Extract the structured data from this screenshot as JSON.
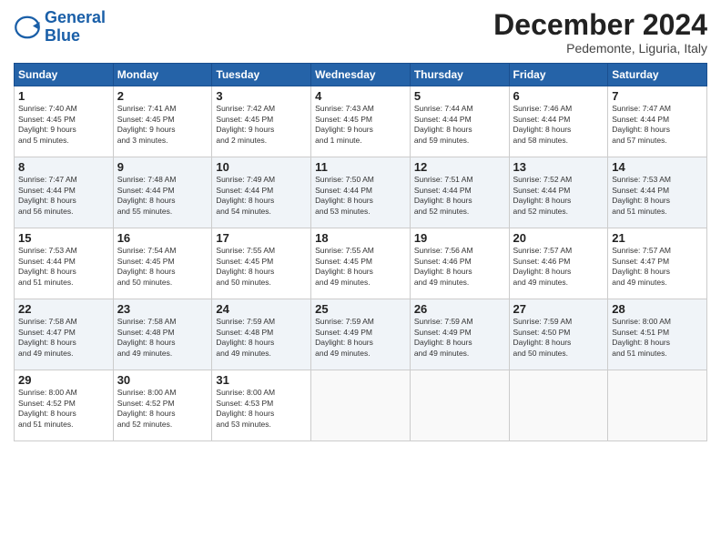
{
  "header": {
    "logo_line1": "General",
    "logo_line2": "Blue",
    "month": "December 2024",
    "location": "Pedemonte, Liguria, Italy"
  },
  "weekdays": [
    "Sunday",
    "Monday",
    "Tuesday",
    "Wednesday",
    "Thursday",
    "Friday",
    "Saturday"
  ],
  "weeks": [
    [
      {
        "day": "1",
        "rise": "7:40 AM",
        "set": "4:45 PM",
        "hours": "9 hours",
        "mins": "5 minutes"
      },
      {
        "day": "2",
        "rise": "7:41 AM",
        "set": "4:45 PM",
        "hours": "9 hours",
        "mins": "3 minutes"
      },
      {
        "day": "3",
        "rise": "7:42 AM",
        "set": "4:45 PM",
        "hours": "9 hours",
        "mins": "2 minutes"
      },
      {
        "day": "4",
        "rise": "7:43 AM",
        "set": "4:45 PM",
        "hours": "9 hours",
        "mins": "1 minute"
      },
      {
        "day": "5",
        "rise": "7:44 AM",
        "set": "4:44 PM",
        "hours": "8 hours",
        "mins": "59 minutes"
      },
      {
        "day": "6",
        "rise": "7:46 AM",
        "set": "4:44 PM",
        "hours": "8 hours",
        "mins": "58 minutes"
      },
      {
        "day": "7",
        "rise": "7:47 AM",
        "set": "4:44 PM",
        "hours": "8 hours",
        "mins": "57 minutes"
      }
    ],
    [
      {
        "day": "8",
        "rise": "7:47 AM",
        "set": "4:44 PM",
        "hours": "8 hours",
        "mins": "56 minutes"
      },
      {
        "day": "9",
        "rise": "7:48 AM",
        "set": "4:44 PM",
        "hours": "8 hours",
        "mins": "55 minutes"
      },
      {
        "day": "10",
        "rise": "7:49 AM",
        "set": "4:44 PM",
        "hours": "8 hours",
        "mins": "54 minutes"
      },
      {
        "day": "11",
        "rise": "7:50 AM",
        "set": "4:44 PM",
        "hours": "8 hours",
        "mins": "53 minutes"
      },
      {
        "day": "12",
        "rise": "7:51 AM",
        "set": "4:44 PM",
        "hours": "8 hours",
        "mins": "52 minutes"
      },
      {
        "day": "13",
        "rise": "7:52 AM",
        "set": "4:44 PM",
        "hours": "8 hours",
        "mins": "52 minutes"
      },
      {
        "day": "14",
        "rise": "7:53 AM",
        "set": "4:44 PM",
        "hours": "8 hours",
        "mins": "51 minutes"
      }
    ],
    [
      {
        "day": "15",
        "rise": "7:53 AM",
        "set": "4:44 PM",
        "hours": "8 hours",
        "mins": "51 minutes"
      },
      {
        "day": "16",
        "rise": "7:54 AM",
        "set": "4:45 PM",
        "hours": "8 hours",
        "mins": "50 minutes"
      },
      {
        "day": "17",
        "rise": "7:55 AM",
        "set": "4:45 PM",
        "hours": "8 hours",
        "mins": "50 minutes"
      },
      {
        "day": "18",
        "rise": "7:55 AM",
        "set": "4:45 PM",
        "hours": "8 hours",
        "mins": "49 minutes"
      },
      {
        "day": "19",
        "rise": "7:56 AM",
        "set": "4:46 PM",
        "hours": "8 hours",
        "mins": "49 minutes"
      },
      {
        "day": "20",
        "rise": "7:57 AM",
        "set": "4:46 PM",
        "hours": "8 hours",
        "mins": "49 minutes"
      },
      {
        "day": "21",
        "rise": "7:57 AM",
        "set": "4:47 PM",
        "hours": "8 hours",
        "mins": "49 minutes"
      }
    ],
    [
      {
        "day": "22",
        "rise": "7:58 AM",
        "set": "4:47 PM",
        "hours": "8 hours",
        "mins": "49 minutes"
      },
      {
        "day": "23",
        "rise": "7:58 AM",
        "set": "4:48 PM",
        "hours": "8 hours",
        "mins": "49 minutes"
      },
      {
        "day": "24",
        "rise": "7:59 AM",
        "set": "4:48 PM",
        "hours": "8 hours",
        "mins": "49 minutes"
      },
      {
        "day": "25",
        "rise": "7:59 AM",
        "set": "4:49 PM",
        "hours": "8 hours",
        "mins": "49 minutes"
      },
      {
        "day": "26",
        "rise": "7:59 AM",
        "set": "4:49 PM",
        "hours": "8 hours",
        "mins": "49 minutes"
      },
      {
        "day": "27",
        "rise": "7:59 AM",
        "set": "4:50 PM",
        "hours": "8 hours",
        "mins": "50 minutes"
      },
      {
        "day": "28",
        "rise": "8:00 AM",
        "set": "4:51 PM",
        "hours": "8 hours",
        "mins": "51 minutes"
      }
    ],
    [
      {
        "day": "29",
        "rise": "8:00 AM",
        "set": "4:52 PM",
        "hours": "8 hours",
        "mins": "51 minutes"
      },
      {
        "day": "30",
        "rise": "8:00 AM",
        "set": "4:52 PM",
        "hours": "8 hours",
        "mins": "52 minutes"
      },
      {
        "day": "31",
        "rise": "8:00 AM",
        "set": "4:53 PM",
        "hours": "8 hours",
        "mins": "53 minutes"
      },
      null,
      null,
      null,
      null
    ]
  ],
  "labels": {
    "sunrise": "Sunrise:",
    "sunset": "Sunset:",
    "daylight": "Daylight:"
  }
}
